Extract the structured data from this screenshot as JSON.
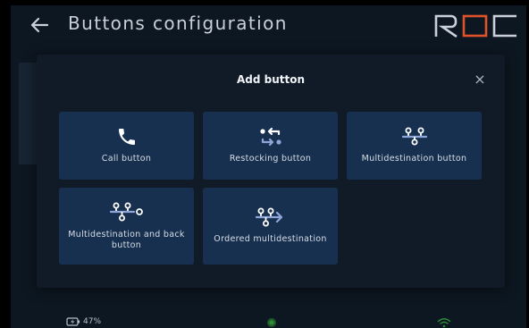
{
  "header": {
    "title": "Buttons configuration",
    "logo_text": "ROC"
  },
  "modal": {
    "title": "Add button",
    "close_symbol": "×",
    "tiles": [
      {
        "label": "Call button",
        "icon": "phone-icon"
      },
      {
        "label": "Restocking button",
        "icon": "restocking-icon"
      },
      {
        "label": "Multidestination button",
        "icon": "multidestination-icon"
      },
      {
        "label": "Multidestination and back button",
        "icon": "multidestination-back-icon"
      },
      {
        "label": "Ordered multidestination",
        "icon": "ordered-multidestination-icon"
      }
    ]
  },
  "status_bar": {
    "battery": "47%"
  },
  "colors": {
    "background": "#0d1721",
    "modal": "#101b27",
    "tile": "#17304f",
    "icon_white": "#ffffff",
    "icon_accent": "#8fa6d8",
    "logo_accent": "#e0522a",
    "status_green": "#2f8a3a"
  }
}
